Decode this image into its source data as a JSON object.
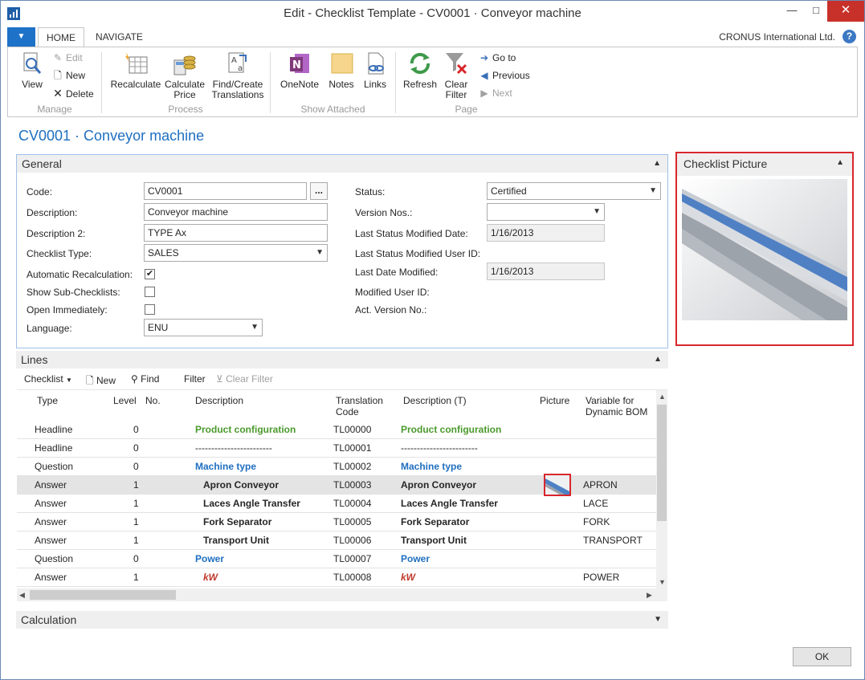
{
  "window": {
    "title": "Edit - Checklist Template - CV0001 · Conveyor machine",
    "minimize": "—",
    "maximize": "□",
    "close": "✕"
  },
  "ribbon": {
    "tabs": [
      "HOME",
      "NAVIGATE"
    ],
    "company": "CRONUS International Ltd.",
    "help": "?",
    "groups": {
      "manage": {
        "label": "Manage",
        "view": "View",
        "edit": "Edit",
        "new": "New",
        "delete": "Delete"
      },
      "process": {
        "label": "Process",
        "recalculate": "Recalculate",
        "calc_price_1": "Calculate",
        "calc_price_2": "Price",
        "find_create_1": "Find/Create",
        "find_create_2": "Translations"
      },
      "show_attached": {
        "label": "Show Attached",
        "onenote": "OneNote",
        "notes": "Notes",
        "links": "Links"
      },
      "page": {
        "label": "Page",
        "refresh": "Refresh",
        "clear_filter_1": "Clear",
        "clear_filter_2": "Filter",
        "goto": "Go to",
        "previous": "Previous",
        "next": "Next"
      }
    }
  },
  "page_title": "CV0001 · Conveyor machine",
  "general": {
    "title": "General",
    "code_label": "Code:",
    "code": "CV0001",
    "assist": "...",
    "description_label": "Description:",
    "description": "Conveyor machine",
    "description2_label": "Description 2:",
    "description2": "TYPE Ax",
    "checklist_type_label": "Checklist Type:",
    "checklist_type": "SALES",
    "auto_recalc_label": "Automatic Recalculation:",
    "auto_recalc": "✔",
    "show_sub_label": "Show Sub-Checklists:",
    "open_immediately_label": "Open Immediately:",
    "language_label": "Language:",
    "language": "ENU",
    "status_label": "Status:",
    "status": "Certified",
    "version_nos_label": "Version Nos.:",
    "version_nos": "",
    "last_status_date_label": "Last Status Modified Date:",
    "last_status_date": "1/16/2013",
    "last_status_user_label": "Last Status Modified User ID:",
    "last_date_modified_label": "Last Date Modified:",
    "last_date_modified": "1/16/2013",
    "modified_user_label": "Modified User ID:",
    "act_version_label": "Act. Version No.:"
  },
  "picture_panel": {
    "title": "Checklist Picture"
  },
  "lines": {
    "title": "Lines",
    "toolbar": {
      "checklist": "Checklist",
      "new": "New",
      "find": "Find",
      "filter": "Filter",
      "clear_filter": "Clear Filter"
    },
    "headers": {
      "type": "Type",
      "level": "Level",
      "no": "No.",
      "description": "Description",
      "translation_code_1": "Translation",
      "translation_code_2": "Code",
      "description_t": "Description (T)",
      "picture": "Picture",
      "variable_1": "Variable for",
      "variable_2": "Dynamic BOM"
    },
    "rows": [
      {
        "type": "Headline",
        "level": "0",
        "no": "",
        "description": "Product configuration",
        "code": "TL00000",
        "description_t": "Product configuration",
        "variable": "",
        "style": "green"
      },
      {
        "type": "Headline",
        "level": "0",
        "no": "",
        "description": "------------------------",
        "code": "TL00001",
        "description_t": "------------------------",
        "variable": "",
        "style": "plain"
      },
      {
        "type": "Question",
        "level": "0",
        "no": "",
        "description": "Machine type",
        "code": "TL00002",
        "description_t": "Machine type",
        "variable": "",
        "style": "blue"
      },
      {
        "type": "Answer",
        "level": "1",
        "no": "",
        "description": "Apron Conveyor",
        "code": "TL00003",
        "description_t": "Apron Conveyor",
        "variable": "APRON",
        "style": "bold"
      },
      {
        "type": "Answer",
        "level": "1",
        "no": "",
        "description": "Laces Angle Transfer",
        "code": "TL00004",
        "description_t": "Laces Angle Transfer",
        "variable": "LACE",
        "style": "bold"
      },
      {
        "type": "Answer",
        "level": "1",
        "no": "",
        "description": "Fork Separator",
        "code": "TL00005",
        "description_t": "Fork Separator",
        "variable": "FORK",
        "style": "bold"
      },
      {
        "type": "Answer",
        "level": "1",
        "no": "",
        "description": "Transport Unit",
        "code": "TL00006",
        "description_t": "Transport Unit",
        "variable": "TRANSPORT",
        "style": "bold"
      },
      {
        "type": "Question",
        "level": "0",
        "no": "",
        "description": "Power",
        "code": "TL00007",
        "description_t": "Power",
        "variable": "",
        "style": "blue"
      },
      {
        "type": "Answer",
        "level": "1",
        "no": "",
        "description": "kW",
        "code": "TL00008",
        "description_t": "kW",
        "variable": "POWER",
        "style": "red"
      }
    ],
    "selected_row": 3
  },
  "calculation": {
    "title": "Calculation"
  },
  "ok_button": "OK",
  "colors": {
    "accent": "#1f6fc0",
    "highlight_border": "#d9262c",
    "green_text": "#4b9a2c",
    "red_text": "#c0392b"
  }
}
